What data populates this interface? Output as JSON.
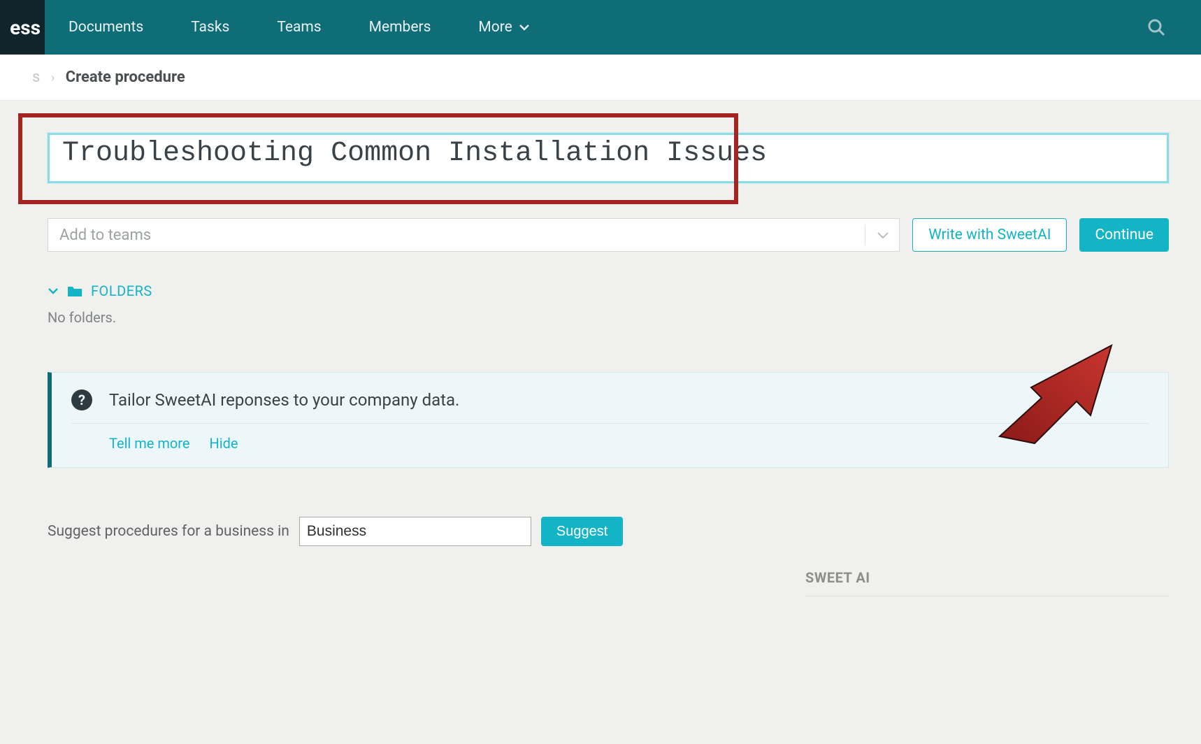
{
  "nav": {
    "logo_fragment": "ess",
    "items": [
      "Documents",
      "Tasks",
      "Teams",
      "Members",
      "More"
    ]
  },
  "breadcrumb": {
    "prev_fragment": "s",
    "current": "Create procedure"
  },
  "title": {
    "value": "Troubleshooting Common Installation Issues"
  },
  "teams": {
    "placeholder": "Add to teams"
  },
  "buttons": {
    "write_ai": "Write with SweetAI",
    "continue": "Continue"
  },
  "folders": {
    "label": "FOLDERS",
    "empty": "No folders."
  },
  "callout": {
    "text": "Tailor SweetAI reponses to your company data.",
    "tell_more": "Tell me more",
    "hide": "Hide"
  },
  "suggest": {
    "prompt": "Suggest procedures for a business in",
    "value": "Business",
    "button": "Suggest"
  },
  "panel": {
    "sweet_ai": "SWEET AI"
  }
}
